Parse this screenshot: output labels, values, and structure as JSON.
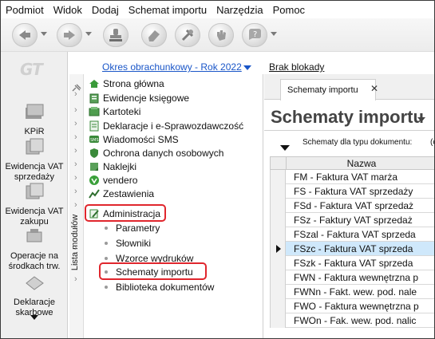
{
  "menu": [
    "Podmiot",
    "Widok",
    "Dodaj",
    "Schemat importu",
    "Narzędzia",
    "Pomoc"
  ],
  "toolbar": {
    "buttons": [
      "back-icon",
      "forward-icon",
      "stamp-icon",
      "eraser-icon",
      "tools-icon",
      "hand-icon",
      "help-icon"
    ]
  },
  "header": {
    "period_link": "Okres obrachunkowy - Rok 2022",
    "unlock_link": "Brak blokady"
  },
  "rail": {
    "logo": "GT",
    "items": [
      {
        "label": "KPiR",
        "icon": "books-icon"
      },
      {
        "label": "Ewidencja VAT sprzedaży",
        "icon": "register-sales-icon"
      },
      {
        "label": "Ewidencja VAT zakupu",
        "icon": "register-purchase-icon"
      },
      {
        "label": "Operacje na środkach trw.",
        "icon": "fixed-assets-icon"
      },
      {
        "label": "Deklaracje skarbowe",
        "icon": "tax-declarations-icon"
      }
    ]
  },
  "modules": {
    "vertical_label": "Lista modułów",
    "items": [
      {
        "label": "Strona główna",
        "icon": "home-icon"
      },
      {
        "label": "Ewidencje księgowe",
        "icon": "ledger-icon"
      },
      {
        "label": "Kartoteki",
        "icon": "card-file-icon"
      },
      {
        "label": "Deklaracje i e-Sprawozdawczość",
        "icon": "declaration-icon"
      },
      {
        "label": "Wiadomości SMS",
        "icon": "sms-icon"
      },
      {
        "label": "Ochrona danych osobowych",
        "icon": "shield-icon"
      },
      {
        "label": "Naklejki",
        "icon": "sticker-icon"
      },
      {
        "label": "vendero",
        "icon": "vendero-icon"
      },
      {
        "label": "Zestawienia",
        "icon": "report-icon"
      },
      {
        "label": "Administracja",
        "icon": "admin-icon"
      }
    ],
    "subitems": [
      "Parametry",
      "Słowniki",
      "Wzorce wydruków",
      "Schematy importu",
      "Biblioteka dokumentów"
    ]
  },
  "right": {
    "tab_label": "Schematy importu",
    "title": "Schematy importu",
    "type_label": "Schematy dla typu dokumentu:",
    "type_value": "(c",
    "column_header": "Nazwa",
    "rows": [
      "FM - Faktura VAT marża",
      "FS - Faktura VAT sprzedaży",
      "FSd - Faktura VAT sprzedaż",
      "FSz - Faktury VAT sprzedaż",
      "FSzal - Faktura VAT sprzeda",
      "FSzc - Faktura VAT sprzeda",
      "FSzk - Faktura VAT sprzeda",
      "FWN - Faktura wewnętrzna p",
      "FWNn - Fakt. wew. pod. nale",
      "FWO - Faktura wewnętrzna p",
      "FWOn - Fak. wew. pod. nalic"
    ],
    "selected_index": 5
  },
  "colors": {
    "highlight": "#e0262d",
    "link": "#1a56c8",
    "selection": "#cfe8fb"
  }
}
